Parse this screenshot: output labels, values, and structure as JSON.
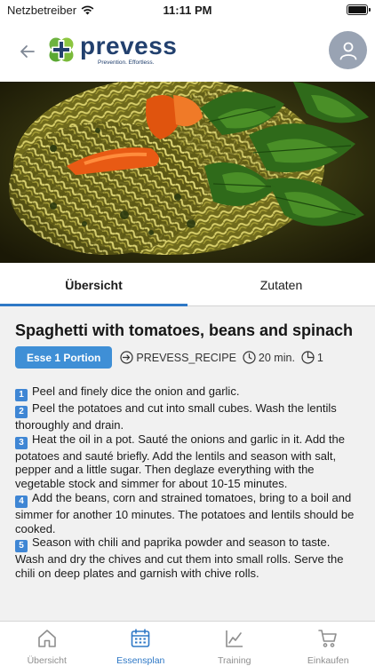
{
  "status_bar": {
    "carrier": "Netzbetreiber",
    "time": "11:11 PM"
  },
  "header": {
    "logo_name": "prevess",
    "logo_tagline": "Prevention. Effortless."
  },
  "tabs": [
    {
      "label": "Übersicht",
      "active": true
    },
    {
      "label": "Zutaten",
      "active": false
    }
  ],
  "recipe": {
    "title": "Spaghetti with tomatoes, beans and spinach",
    "portion_button": "Esse 1 Portion",
    "source": "PREVESS_RECIPE",
    "duration": "20 min.",
    "servings": "1",
    "steps": [
      {
        "num": "1",
        "text": "Peel and finely dice the onion and garlic."
      },
      {
        "num": "2",
        "text": "Peel the potatoes and cut into small cubes. Wash the lentils thoroughly and drain."
      },
      {
        "num": "3",
        "text": "Heat the oil in a pot. Sauté the onions and garlic in it. Add the potatoes and sauté briefly. Add the lentils and season with salt, pepper and a little sugar. Then deglaze everything with the vegetable stock and simmer for about 10-15 minutes."
      },
      {
        "num": "4",
        "text": "Add the beans, corn and strained tomatoes, bring to a boil and simmer for another 10 minutes. The potatoes and lentils should be cooked."
      },
      {
        "num": "5",
        "text": "Season with chili and paprika powder and season to taste. Wash and dry the chives and cut them into small rolls. Serve the chili on deep plates and garnish with chive rolls."
      }
    ]
  },
  "bottom_nav": [
    {
      "label": "Übersicht",
      "icon": "home-icon",
      "active": false
    },
    {
      "label": "Essensplan",
      "icon": "calendar-icon",
      "active": true
    },
    {
      "label": "Training",
      "icon": "chart-icon",
      "active": false
    },
    {
      "label": "Einkaufen",
      "icon": "cart-icon",
      "active": false
    }
  ],
  "colors": {
    "accent": "#2e78c6",
    "button": "#3f8fd6",
    "brand_navy": "#22406e",
    "brand_green": "#6db33f",
    "avatar_bg": "#99a3b3",
    "inactive": "#8e8e8e"
  }
}
